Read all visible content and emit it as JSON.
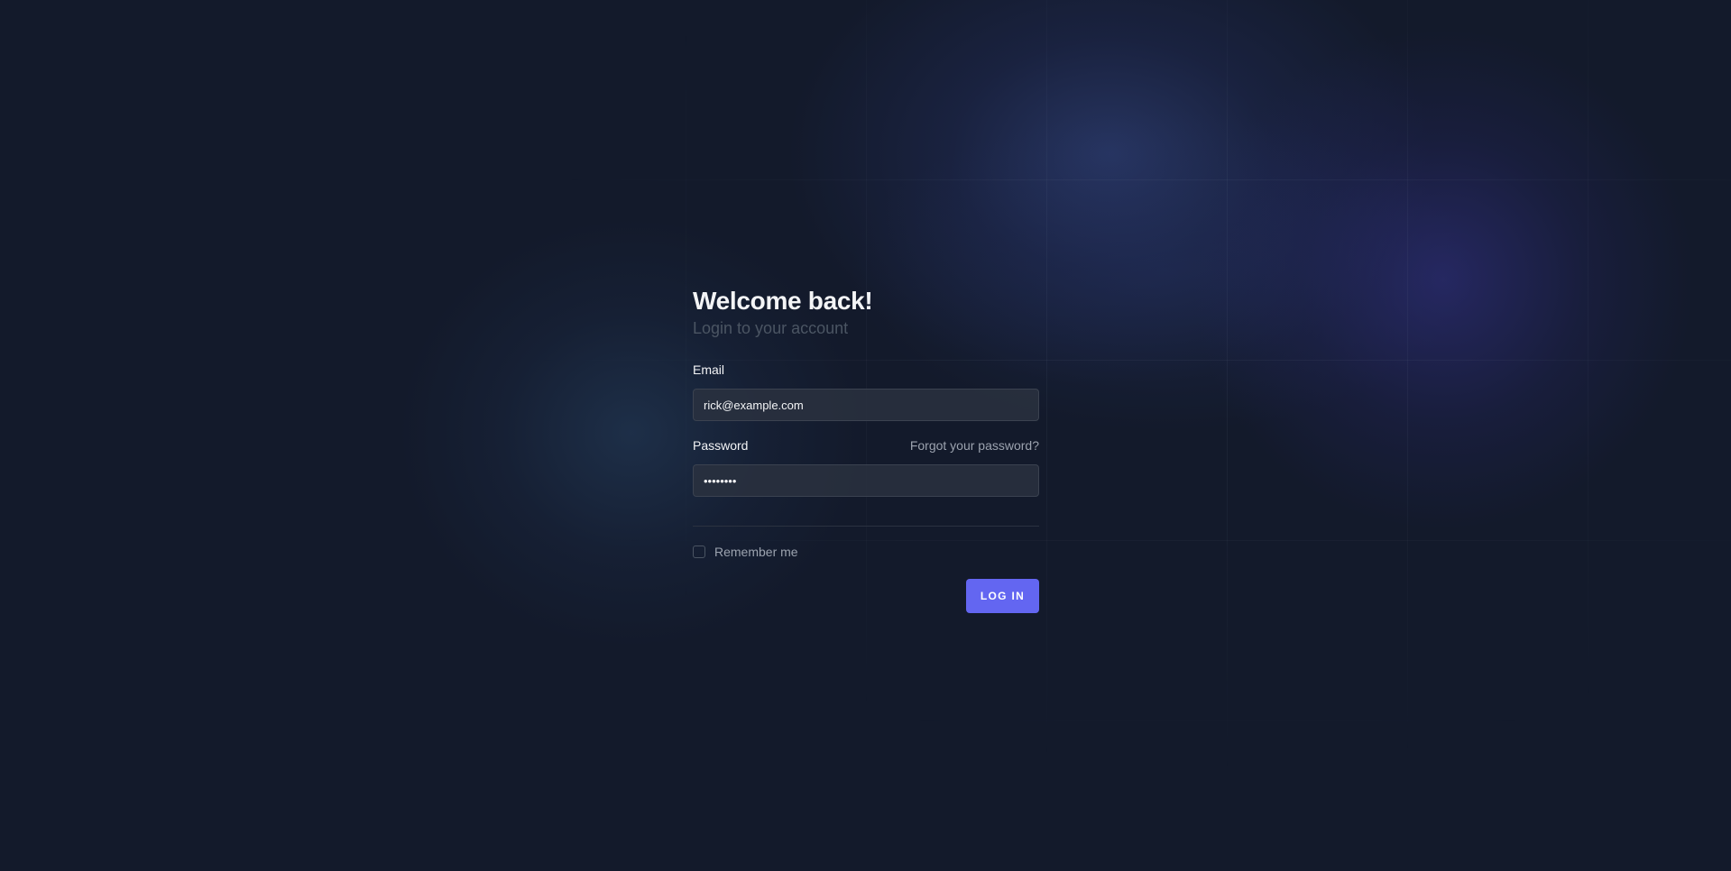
{
  "login": {
    "title": "Welcome back!",
    "subtitle": "Login to your account",
    "email": {
      "label": "Email",
      "value": "rick@example.com"
    },
    "password": {
      "label": "Password",
      "value": "••••••••",
      "forgot_link": "Forgot your password?"
    },
    "remember_me": {
      "label": "Remember me",
      "checked": false
    },
    "submit_label": "LOG IN"
  },
  "colors": {
    "background": "#131a2b",
    "accent": "#6366f1",
    "text": "#f3f4f6",
    "muted": "#9ca3af",
    "subtitle": "#4b5563"
  }
}
